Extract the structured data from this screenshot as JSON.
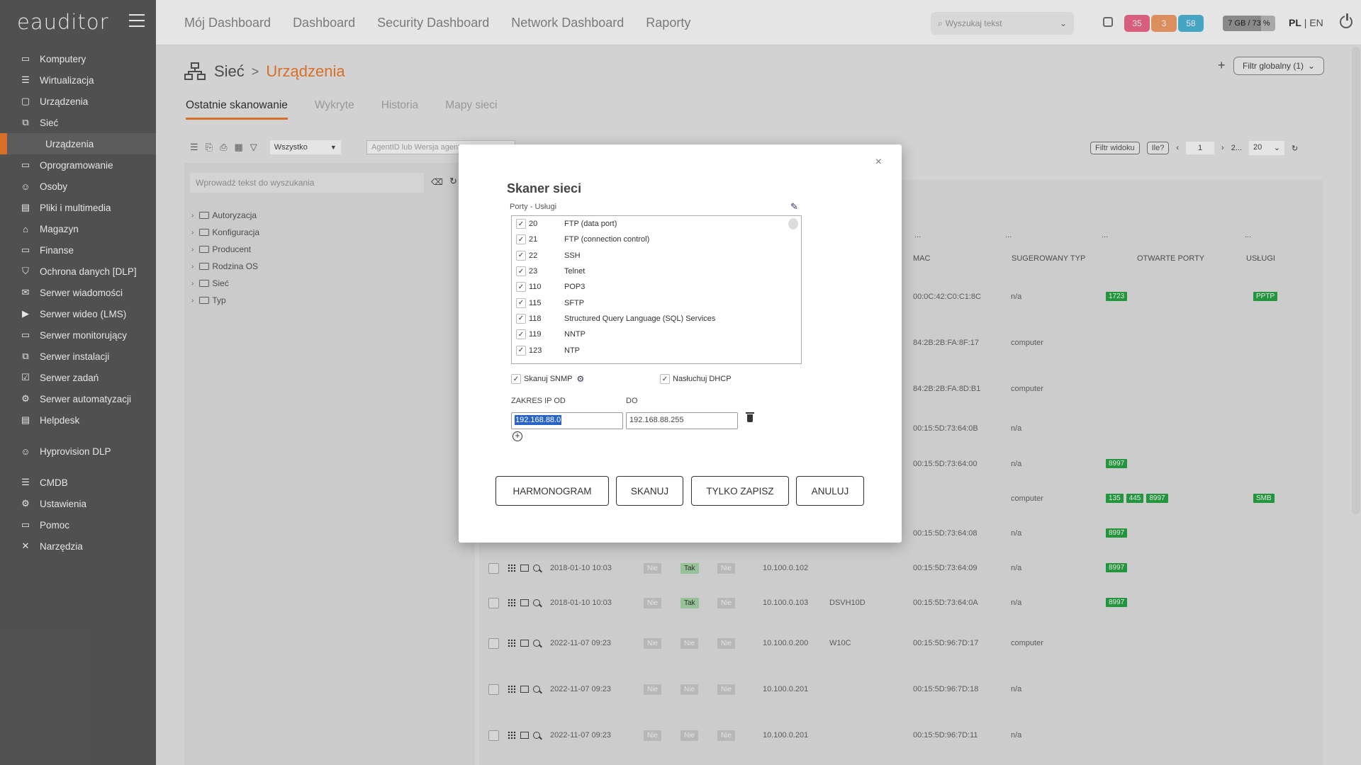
{
  "sidebar": {
    "logo": "eauditor",
    "items": [
      {
        "label": "Komputery",
        "icon": "monitor-icon"
      },
      {
        "label": "Wirtualizacja",
        "icon": "server-icon"
      },
      {
        "label": "Urządzenia",
        "icon": "device-icon"
      },
      {
        "label": "Sieć",
        "icon": "network-icon"
      },
      {
        "label": "Urządzenia",
        "icon": "",
        "sub": true
      },
      {
        "label": "Oprogramowanie",
        "icon": "software-icon"
      },
      {
        "label": "Osoby",
        "icon": "people-icon"
      },
      {
        "label": "Pliki i multimedia",
        "icon": "file-icon"
      },
      {
        "label": "Magazyn",
        "icon": "warehouse-icon"
      },
      {
        "label": "Finanse",
        "icon": "finance-icon"
      },
      {
        "label": "Ochrona danych [DLP]",
        "icon": "shield-icon"
      },
      {
        "label": "Serwer wiadomości",
        "icon": "mail-icon"
      },
      {
        "label": "Serwer wideo (LMS)",
        "icon": "video-icon"
      },
      {
        "label": "Serwer monitorujący",
        "icon": "monitoring-icon"
      },
      {
        "label": "Serwer instalacji",
        "icon": "install-icon"
      },
      {
        "label": "Serwer zadań",
        "icon": "tasks-icon"
      },
      {
        "label": "Serwer automatyzacji",
        "icon": "automation-icon"
      },
      {
        "label": "Helpdesk",
        "icon": "helpdesk-icon"
      },
      {
        "label": "Hyprovision DLP",
        "icon": "people-icon",
        "gap": true
      },
      {
        "label": "CMDB",
        "icon": "database-icon",
        "gap": true
      },
      {
        "label": "Ustawienia",
        "icon": "gear-icon"
      },
      {
        "label": "Pomoc",
        "icon": "help-icon"
      },
      {
        "label": "Narzędzia",
        "icon": "tools-icon"
      }
    ]
  },
  "topnav": [
    "Mój Dashboard",
    "Dashboard",
    "Security Dashboard",
    "Network Dashboard",
    "Raporty"
  ],
  "search": {
    "placeholder": "Wyszukaj tekst"
  },
  "badges": [
    {
      "value": "35",
      "color": "#f06a8a"
    },
    {
      "value": "3",
      "color": "#f4a06a"
    },
    {
      "value": "58",
      "color": "#4fb8d8"
    }
  ],
  "memory": {
    "label": "7 GB / 73 %",
    "fraction": 0.73
  },
  "lang": {
    "pl": "PL",
    "sep": "|",
    "en": "EN"
  },
  "breadcrumb": {
    "part1": "Sieć",
    "part2": "Urządzenia"
  },
  "global_filter": "Filtr globalny (1)",
  "tabs": [
    "Ostatnie skanowanie",
    "Wykryte",
    "Historia",
    "Mapy sieci"
  ],
  "toolbar": {
    "select_value": "Wszystko",
    "agent_placeholder": "AgentID lub Wersja agenta",
    "view_filter": "Filtr widoku",
    "count_btn": "Ile?",
    "page": "1",
    "pages": "2...",
    "per_page": "20"
  },
  "tree": {
    "search_placeholder": "Wprowadź tekst do wyszukania",
    "items": [
      "Autoryzacja",
      "Konfiguracja",
      "Producent",
      "Rodzina OS",
      "Sieć",
      "Typ"
    ]
  },
  "table": {
    "headers": {
      "mac": "MAC",
      "type": "SUGEROWANY TYP",
      "ports": "OTWARTE PORTY",
      "services": "USŁUGI"
    },
    "filter_dots": [
      "...",
      "...",
      "...",
      "..."
    ],
    "rows": [
      {
        "mac": "00:0C:42:C0:C1:8C",
        "type": "n/a",
        "ports": [
          "1723"
        ],
        "services": [
          "PPTP"
        ]
      },
      {
        "mac": "84:2B:2B:FA:8F:17",
        "type": "computer",
        "ports": [],
        "services": []
      },
      {
        "mac": "84:2B:2B:FA:8D:B1",
        "type": "computer",
        "ports": [],
        "services": []
      },
      {
        "mac": "00:15:5D:73:64:0B",
        "type": "n/a",
        "ports": [],
        "services": []
      },
      {
        "mac": "00:15:5D:73:64:00",
        "type": "n/a",
        "ports": [
          "8997"
        ],
        "services": []
      },
      {
        "mac": "",
        "type": "computer",
        "ports": [
          "135",
          "445",
          "8997"
        ],
        "services": [
          "SMB"
        ]
      },
      {
        "mac": "00:15:5D:73:64:08",
        "type": "n/a",
        "ports": [
          "8997"
        ],
        "services": []
      },
      {
        "date": "2018-01-10 10:03",
        "f1": "Nie",
        "f2": "Tak",
        "f3": "Nie",
        "ip": "10.100.0.102",
        "name": "",
        "mac": "00:15:5D:73:64:09",
        "type": "n/a",
        "ports": [
          "8997"
        ],
        "services": []
      },
      {
        "date": "2018-01-10 10:03",
        "f1": "Nie",
        "f2": "Tak",
        "f3": "Nie",
        "ip": "10.100.0.103",
        "name": "DSVH10D",
        "mac": "00:15:5D:73:64:0A",
        "type": "n/a",
        "ports": [
          "8997"
        ],
        "services": []
      },
      {
        "date": "2022-11-07 09:23",
        "f1": "Nie",
        "f2": "Nie",
        "f3": "Nie",
        "ip": "10.100.0.200",
        "name": "W10C",
        "mac": "00:15:5D:96:7D:17",
        "type": "computer",
        "ports": [],
        "services": []
      },
      {
        "date": "2022-11-07 09:23",
        "f1": "Nie",
        "f2": "Nie",
        "f3": "Nie",
        "ip": "10.100.0.201",
        "name": "",
        "mac": "00:15:5D:96:7D:18",
        "type": "n/a",
        "ports": [],
        "services": []
      },
      {
        "date": "2022-11-07 09:23",
        "f1": "Nie",
        "f2": "Nie",
        "f3": "Nie",
        "ip": "10.100.0.201",
        "name": "",
        "mac": "00:15:5D:96:7D:11",
        "type": "n/a",
        "ports": [],
        "services": []
      }
    ]
  },
  "modal": {
    "title": "Skaner sieci",
    "ports_label": "Porty - Usługi",
    "ports": [
      {
        "port": "20",
        "name": "FTP (data port)"
      },
      {
        "port": "21",
        "name": "FTP (connection control)"
      },
      {
        "port": "22",
        "name": "SSH"
      },
      {
        "port": "23",
        "name": "Telnet"
      },
      {
        "port": "110",
        "name": "POP3"
      },
      {
        "port": "115",
        "name": "SFTP"
      },
      {
        "port": "118",
        "name": "Structured Query Language (SQL) Services"
      },
      {
        "port": "119",
        "name": "NNTP"
      },
      {
        "port": "123",
        "name": "NTP"
      }
    ],
    "snmp_label": "Skanuj SNMP",
    "dhcp_label": "Nasłuchuj DHCP",
    "ip_from_label": "ZAKRES IP OD",
    "ip_to_label": "DO",
    "ip_from": "192.168.88.0",
    "ip_to": "192.168.88.255",
    "buttons": {
      "schedule": "HARMONOGRAM",
      "scan": "SKANUJ",
      "save": "TYLKO ZAPISZ",
      "cancel": "ANULUJ"
    },
    "close": "×"
  }
}
